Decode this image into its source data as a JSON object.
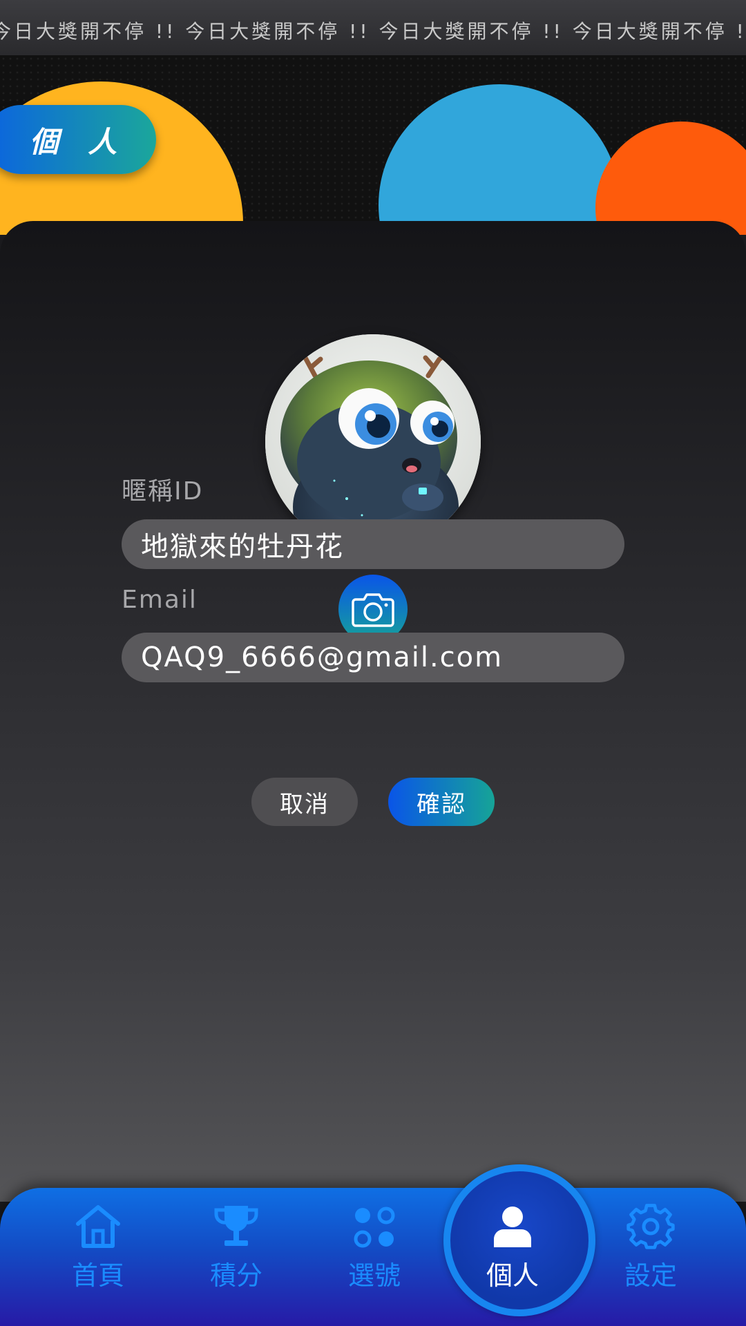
{
  "marquee": {
    "text": "今日大獎開不停 !! 今日大獎開不停 !! 今日大獎開不停 !! 今日大獎開不停 !! 今"
  },
  "header": {
    "section_title": "個 人"
  },
  "profile": {
    "nickname_label": "暱稱ID",
    "nickname_value": "地獄來的牡丹花",
    "email_label": "Email",
    "email_value": "QAQ9_6666@gmail.com"
  },
  "actions": {
    "cancel_label": "取消",
    "confirm_label": "確認"
  },
  "nav": {
    "items": [
      {
        "label": "首頁",
        "icon": "home-icon"
      },
      {
        "label": "積分",
        "icon": "trophy-icon"
      },
      {
        "label": "選號",
        "icon": "dots-grid-icon"
      },
      {
        "label": "個人",
        "icon": "user-icon",
        "active": true
      },
      {
        "label": "設定",
        "icon": "gear-icon"
      }
    ]
  },
  "colors": {
    "accent_blue": "#0a55e8",
    "accent_teal": "#16a497",
    "nav_label": "#1a8cff",
    "yellow": "#ffb41f",
    "sky": "#31a6db",
    "orange": "#fe5b0c"
  }
}
